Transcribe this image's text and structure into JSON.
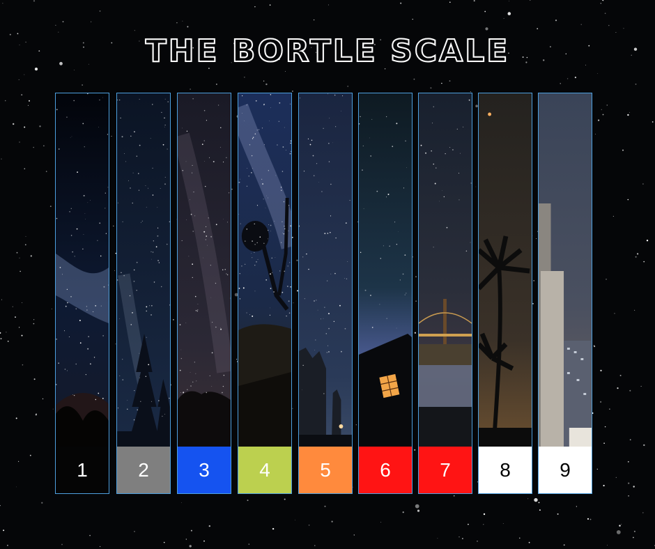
{
  "title": "THE BORTLE SCALE",
  "scale": [
    {
      "label": "1",
      "color": "#050505",
      "text_color": "#ffffff",
      "scene": "dark-sky-milky-way"
    },
    {
      "label": "2",
      "color": "#7f7f7f",
      "text_color": "#ffffff",
      "scene": "pine-trees-milky-way"
    },
    {
      "label": "3",
      "color": "#1553f0",
      "text_color": "#ffffff",
      "scene": "hills-milky-way"
    },
    {
      "label": "4",
      "color": "#bcd04f",
      "text_color": "#ffffff",
      "scene": "joshua-tree-milky-way"
    },
    {
      "label": "5",
      "color": "#ff8a3d",
      "text_color": "#ffffff",
      "scene": "rocks-starry-sky"
    },
    {
      "label": "6",
      "color": "#ff1414",
      "text_color": "#ffffff",
      "scene": "house-window-night"
    },
    {
      "label": "7",
      "color": "#ff1414",
      "text_color": "#ffffff",
      "scene": "bridge-city-lights"
    },
    {
      "label": "8",
      "color": "#ffffff",
      "text_color": "#000000",
      "scene": "palm-trees-city-glow"
    },
    {
      "label": "9",
      "color": "#ffffff",
      "text_color": "#000000",
      "scene": "city-buildings"
    }
  ]
}
